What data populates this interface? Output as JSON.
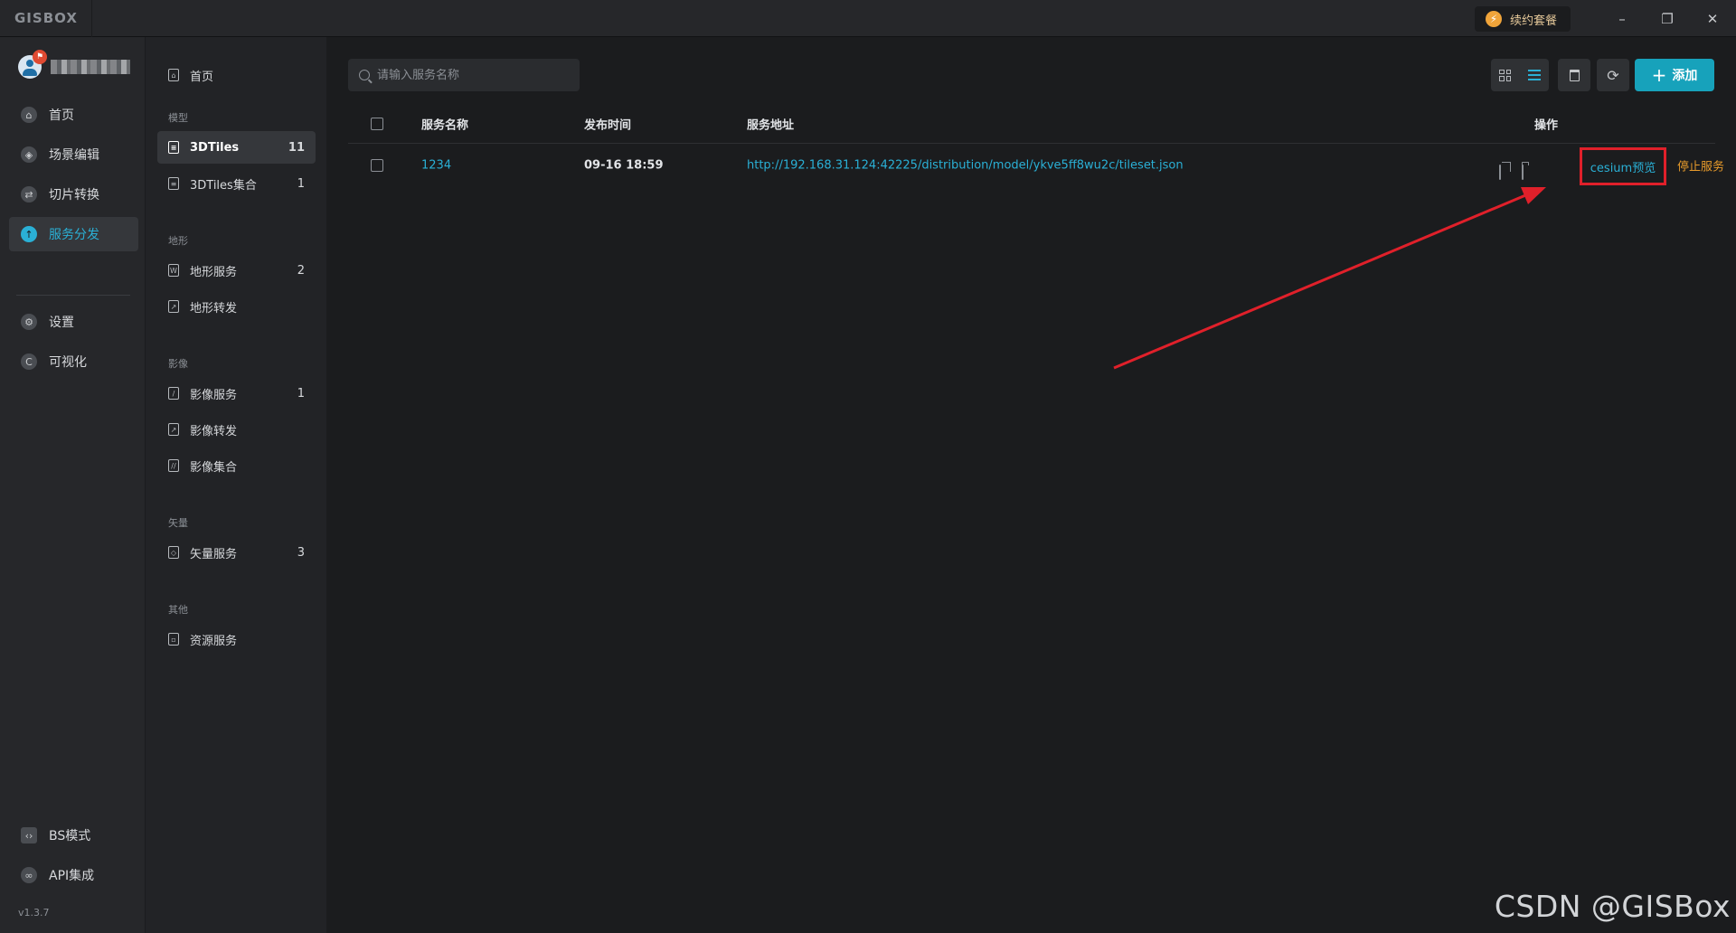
{
  "app": {
    "logo": "GISBOX",
    "renew_label": "续约套餐",
    "version": "v1.3.7"
  },
  "window_controls": {
    "minimize": "–",
    "restore": "❐",
    "close": "✕"
  },
  "leftnav": {
    "items": [
      {
        "label": "首页",
        "icon": "home-icon"
      },
      {
        "label": "场景编辑",
        "icon": "cube-icon"
      },
      {
        "label": "切片转换",
        "icon": "swap-icon"
      },
      {
        "label": "服务分发",
        "icon": "upload-icon",
        "active": true
      },
      {
        "label": "设置",
        "icon": "gear-icon"
      },
      {
        "label": "可视化",
        "icon": "visual-icon"
      }
    ],
    "bottom": [
      {
        "label": "BS模式",
        "icon": "code-icon"
      },
      {
        "label": "API集成",
        "icon": "link-icon"
      }
    ]
  },
  "subnav": {
    "home": "首页",
    "groups": [
      {
        "label": "模型",
        "items": [
          {
            "label": "3DTiles",
            "count": "11",
            "active": true
          },
          {
            "label": "3DTiles集合",
            "count": "1"
          }
        ]
      },
      {
        "label": "地形",
        "items": [
          {
            "label": "地形服务",
            "count": "2"
          },
          {
            "label": "地形转发",
            "count": ""
          }
        ]
      },
      {
        "label": "影像",
        "items": [
          {
            "label": "影像服务",
            "count": "1"
          },
          {
            "label": "影像转发",
            "count": ""
          },
          {
            "label": "影像集合",
            "count": ""
          }
        ]
      },
      {
        "label": "矢量",
        "items": [
          {
            "label": "矢量服务",
            "count": "3"
          }
        ]
      },
      {
        "label": "其他",
        "items": [
          {
            "label": "资源服务",
            "count": ""
          }
        ]
      }
    ]
  },
  "toolbar": {
    "search_placeholder": "请输入服务名称",
    "add_label": "添加"
  },
  "table": {
    "headers": {
      "name": "服务名称",
      "time": "发布时间",
      "url": "服务地址",
      "actions": "操作"
    },
    "rows": [
      {
        "name": "1234",
        "time": "09-16 18:59",
        "url": "http://192.168.31.124:42225/distribution/model/ykve5ff8wu2c/tileset.json",
        "preview": "cesium预览",
        "stop": "停止服务"
      }
    ]
  },
  "colors": {
    "accent": "#17a2bb",
    "link": "#2ab0d6",
    "warning": "#e89b2b",
    "highlight": "#e0202a"
  },
  "watermark": "CSDN @GISBox"
}
